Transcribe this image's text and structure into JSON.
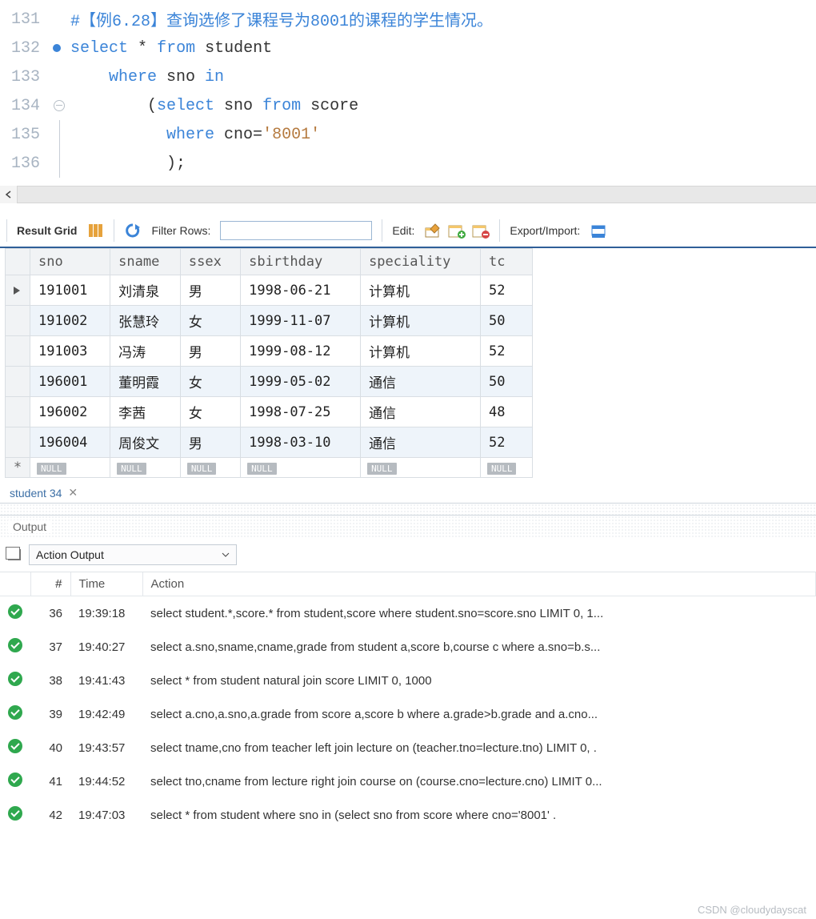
{
  "editor": {
    "lines": [
      {
        "no": 131,
        "bp": false,
        "fold": "",
        "html": "<span class='cm'>#【例6.28】查询选修了课程号为8001的课程的学生情况。</span>"
      },
      {
        "no": 132,
        "bp": true,
        "fold": "",
        "html": "<span class='kw'>select</span> <span class='op'>*</span> <span class='kw'>from</span> student"
      },
      {
        "no": 133,
        "bp": false,
        "fold": "",
        "html": "    <span class='kw'>where</span> sno <span class='kw'>in</span>"
      },
      {
        "no": 134,
        "bp": false,
        "fold": "open",
        "html": "        (<span class='kw'>select</span> sno <span class='kw'>from</span> score"
      },
      {
        "no": 135,
        "bp": false,
        "fold": "line",
        "html": "          <span class='kw'>where</span> cno=<span class='str'>'8001'</span>"
      },
      {
        "no": 136,
        "bp": false,
        "fold": "line",
        "html": "          );"
      }
    ]
  },
  "toolbar": {
    "result_grid": "Result Grid",
    "filter_label": "Filter Rows:",
    "filter_value": "",
    "edit_label": "Edit:",
    "export_label": "Export/Import:"
  },
  "grid": {
    "columns": [
      "sno",
      "sname",
      "ssex",
      "sbirthday",
      "speciality",
      "tc"
    ],
    "rows": [
      [
        "191001",
        "刘清泉",
        "男",
        "1998-06-21",
        "计算机",
        "52"
      ],
      [
        "191002",
        "张慧玲",
        "女",
        "1999-11-07",
        "计算机",
        "50"
      ],
      [
        "191003",
        "冯涛",
        "男",
        "1999-08-12",
        "计算机",
        "52"
      ],
      [
        "196001",
        "董明霞",
        "女",
        "1999-05-02",
        "通信",
        "50"
      ],
      [
        "196002",
        "李茜",
        "女",
        "1998-07-25",
        "通信",
        "48"
      ],
      [
        "196004",
        "周俊文",
        "男",
        "1998-03-10",
        "通信",
        "52"
      ]
    ],
    "null_label": "NULL"
  },
  "tab": {
    "label": "student 34"
  },
  "output": {
    "title": "Output",
    "dropdown": "Action Output",
    "headers": [
      "#",
      "Time",
      "Action"
    ],
    "rows": [
      {
        "n": 36,
        "t": "19:39:18",
        "a": "select student.*,score.* from student,score where student.sno=score.sno LIMIT 0, 1..."
      },
      {
        "n": 37,
        "t": "19:40:27",
        "a": "select a.sno,sname,cname,grade from student a,score b,course c where a.sno=b.s..."
      },
      {
        "n": 38,
        "t": "19:41:43",
        "a": "select * from student natural join score LIMIT 0, 1000"
      },
      {
        "n": 39,
        "t": "19:42:49",
        "a": "select a.cno,a.sno,a.grade from score a,score b where a.grade>b.grade and a.cno..."
      },
      {
        "n": 40,
        "t": "19:43:57",
        "a": "select tname,cno from teacher left join lecture on (teacher.tno=lecture.tno) LIMIT 0, ."
      },
      {
        "n": 41,
        "t": "19:44:52",
        "a": "select tno,cname from lecture right join course on (course.cno=lecture.cno) LIMIT 0..."
      },
      {
        "n": 42,
        "t": "19:47:03",
        "a": "select * from student where sno in  (select sno from score             where cno='8001'   ."
      }
    ]
  },
  "watermark": "CSDN @cloudydayscat"
}
